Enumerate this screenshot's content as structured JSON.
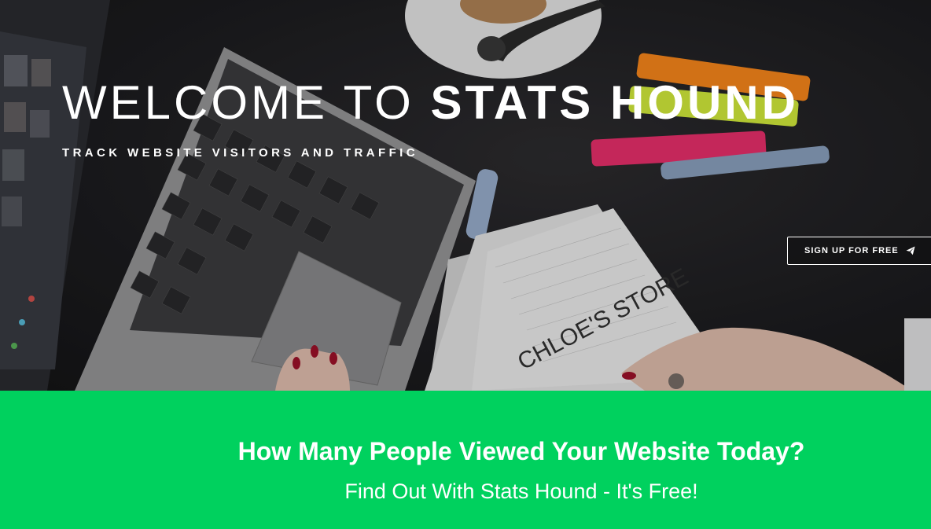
{
  "hero": {
    "title_prefix": "WELCOME TO ",
    "title_brand": "STATS HOUND",
    "subtitle": "TRACK WEBSITE VISITORS AND TRAFFIC",
    "signup_label": "SIGN UP FOR FREE",
    "signup_icon": "paper-plane-icon"
  },
  "photo": {
    "notebook_text": "CHLOE'S STORE"
  },
  "cta": {
    "headline": "How Many People Viewed Your Website Today?",
    "subline": "Find Out With Stats Hound - It's Free!"
  },
  "colors": {
    "band_green": "#00d15e",
    "hero_text": "#ffffff"
  }
}
